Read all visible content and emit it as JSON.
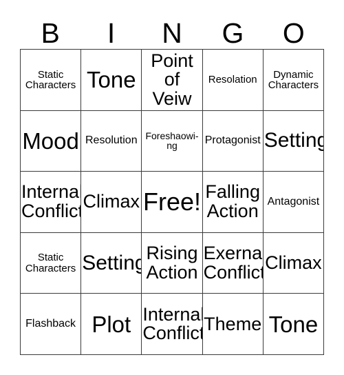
{
  "header": {
    "letters": [
      "B",
      "I",
      "N",
      "G",
      "O"
    ]
  },
  "grid": {
    "rows": 5,
    "columns": 5,
    "border_color": "#3a3a3a",
    "background_color": "#ffffff",
    "text_color": "#000000",
    "cells": [
      {
        "text": "Static\nCharacters",
        "size": "xxs"
      },
      {
        "text": "Tone",
        "size": "lg"
      },
      {
        "text": "Point\nof Veiw",
        "size": "md"
      },
      {
        "text": "Resolation",
        "size": "xxs"
      },
      {
        "text": "Dynamic\nCharacters",
        "size": "xxs"
      },
      {
        "text": "Mood",
        "size": "lg"
      },
      {
        "text": "Resolution",
        "size": "xs"
      },
      {
        "text": "Foreshaowi-\nng",
        "size": "tiny"
      },
      {
        "text": "Protagonist",
        "size": "xs"
      },
      {
        "text": "Setting",
        "size": "mdl"
      },
      {
        "text": "Internal\nConflict",
        "size": "md"
      },
      {
        "text": "Climax",
        "size": "md"
      },
      {
        "text": "Free!",
        "size": "xl"
      },
      {
        "text": "Falling\nAction",
        "size": "md"
      },
      {
        "text": "Antagonist",
        "size": "xs"
      },
      {
        "text": "Static\nCharacters",
        "size": "xxs"
      },
      {
        "text": "Setting",
        "size": "mdl"
      },
      {
        "text": "Rising\nAction",
        "size": "md"
      },
      {
        "text": "Exernal\nConflict",
        "size": "md"
      },
      {
        "text": "Climax",
        "size": "md"
      },
      {
        "text": "Flashback",
        "size": "xs"
      },
      {
        "text": "Plot",
        "size": "lg"
      },
      {
        "text": "Internal\nConflict",
        "size": "md"
      },
      {
        "text": "Theme",
        "size": "md"
      },
      {
        "text": "Tone",
        "size": "lg"
      }
    ]
  }
}
